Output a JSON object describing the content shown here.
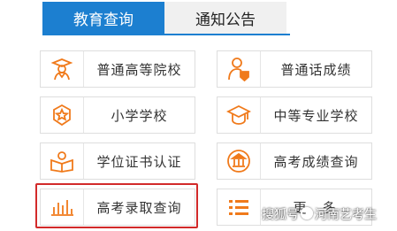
{
  "tabs": [
    {
      "label": "教育查询",
      "active": true
    },
    {
      "label": "通知公告",
      "active": false
    }
  ],
  "cards": [
    {
      "label": "普通高等院校",
      "icon": "graduate-icon"
    },
    {
      "label": "普通话成绩",
      "icon": "person-check-icon"
    },
    {
      "label": "小学学校",
      "icon": "star-badge-icon"
    },
    {
      "label": "中等专业学校",
      "icon": "mortarboard-icon"
    },
    {
      "label": "学位证书认证",
      "icon": "open-book-icon"
    },
    {
      "label": "高考成绩查询",
      "icon": "exam-building-icon"
    },
    {
      "label": "高考录取查询",
      "icon": "bar-chart-icon"
    },
    {
      "label": "更多",
      "icon": "menu-list-icon"
    }
  ],
  "watermark": {
    "prefix": "搜狐号",
    "suffix": "河南艺考生"
  },
  "colors": {
    "accent": "#1c7fd0",
    "icon": "#f07a1b",
    "highlight": "#d22a2a"
  }
}
